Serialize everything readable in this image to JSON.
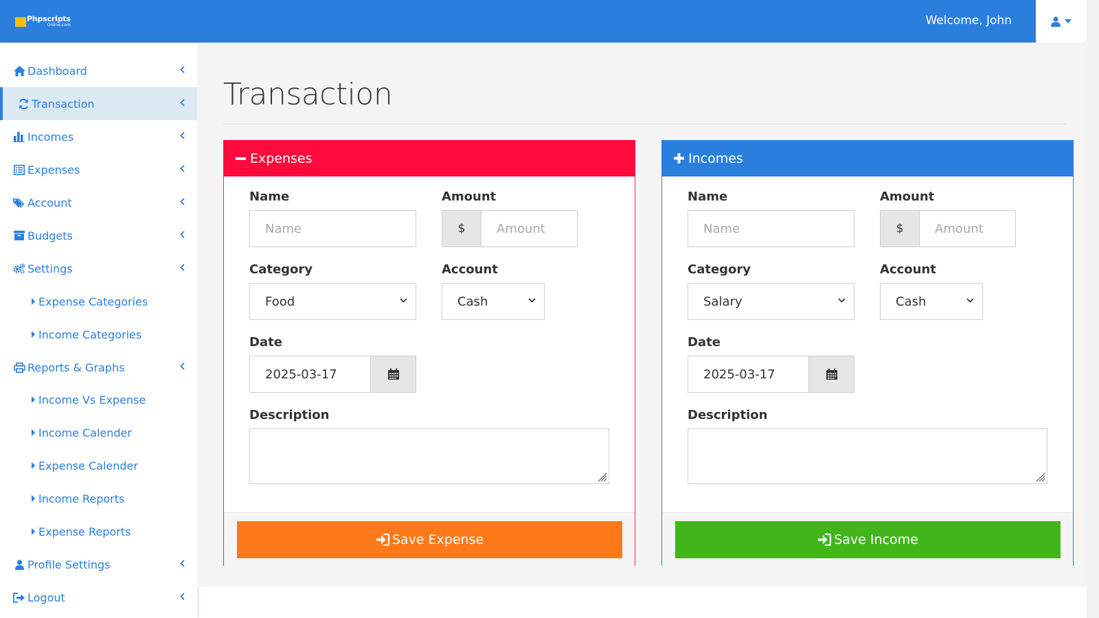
{
  "header": {
    "logo_main": "Phpscripts",
    "logo_sub": "Online.com",
    "welcome": "Welcome, John",
    "accent": "#2a7fdd"
  },
  "sidebar": {
    "items": [
      {
        "label": "Dashboard",
        "icon": "home-icon"
      },
      {
        "label": "Transaction",
        "icon": "refresh-icon",
        "active": true
      },
      {
        "label": "Incomes",
        "icon": "bar-chart-icon"
      },
      {
        "label": "Expenses",
        "icon": "list-icon"
      },
      {
        "label": "Account",
        "icon": "tags-icon"
      },
      {
        "label": "Budgets",
        "icon": "archive-icon"
      },
      {
        "label": "Settings",
        "icon": "gears-icon"
      },
      {
        "label": "Reports & Graphs",
        "icon": "print-icon"
      },
      {
        "label": "Profile Settings",
        "icon": "user-icon"
      },
      {
        "label": "Logout",
        "icon": "sign-out-icon"
      }
    ],
    "settings_sub": [
      "Expense Categories",
      "Income Categories"
    ],
    "reports_sub": [
      "Income Vs Expense",
      "Income Calender",
      "Expense Calender",
      "Income Reports",
      "Expense Reports"
    ]
  },
  "page": {
    "title": "Transaction"
  },
  "expense_panel": {
    "title": "Expenses",
    "color": "#ff0a3c",
    "name_label": "Name",
    "name_placeholder": "Name",
    "amount_label": "Amount",
    "currency": "$",
    "amount_placeholder": "Amount",
    "category_label": "Category",
    "category_value": "Food",
    "account_label": "Account",
    "account_value": "Cash",
    "date_label": "Date",
    "date_value": "2025-03-17",
    "description_label": "Description",
    "save_label": "Save Expense",
    "save_color": "#fd791a"
  },
  "income_panel": {
    "title": "Incomes",
    "color": "#2a7fdd",
    "name_label": "Name",
    "name_placeholder": "Name",
    "amount_label": "Amount",
    "currency": "$",
    "amount_placeholder": "Amount",
    "category_label": "Category",
    "category_value": "Salary",
    "account_label": "Account",
    "account_value": "Cash",
    "date_label": "Date",
    "date_value": "2025-03-17",
    "description_label": "Description",
    "save_label": "Save Income",
    "save_color": "#42b51b"
  }
}
